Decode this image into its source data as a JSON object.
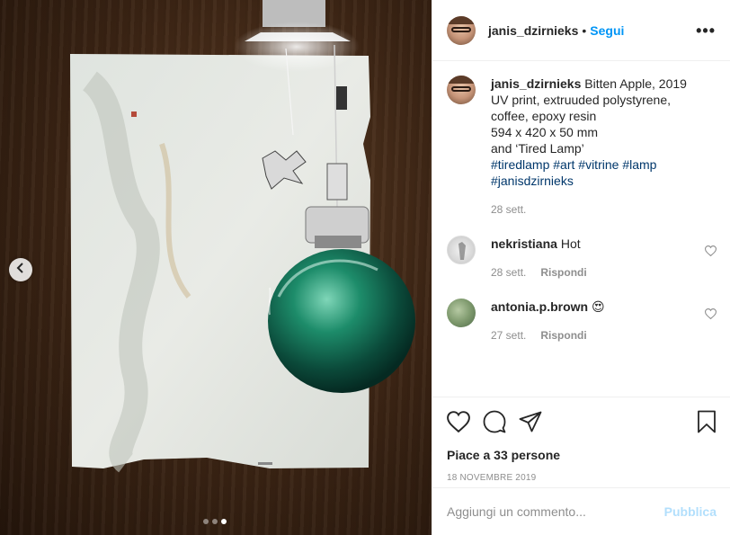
{
  "post": {
    "author": "janis_dzirnieks",
    "separator": "•",
    "follow_label": "Segui",
    "more_label": "•••",
    "caption_lines": [
      "Bitten Apple, 2019",
      "UV print, extruuded polystyrene,",
      "coffee, epoxy resin",
      "594 x 420 x 50 mm",
      "and ‘Tired Lamp’"
    ],
    "hashtags": [
      "#tiredlamp",
      "#art",
      "#vitrine",
      "#lamp",
      "#janisdzirnieks"
    ],
    "caption_age": "28 sett.",
    "likes": "Piace a 33 persone",
    "date": "18 novembre 2019"
  },
  "comments": [
    {
      "user": "nekristiana",
      "text": "Hot",
      "age": "28 sett.",
      "reply": "Rispondi"
    },
    {
      "user": "antonia.p.brown",
      "text": "😍",
      "age": "27 sett.",
      "reply": "Rispondi"
    }
  ],
  "comment_box": {
    "placeholder": "Aggiungi un commento...",
    "publish_label": "Pubblica"
  },
  "carousel": {
    "slides": 3,
    "active_index": 2
  },
  "colors": {
    "link": "#0095f6",
    "hashtag": "#00376b",
    "muted": "#8e8e8e",
    "publish_disabled": "#b2dffc",
    "heart_red": "#ed4956"
  },
  "icons": [
    "chevron-left-icon",
    "heart-icon",
    "comment-icon",
    "share-icon",
    "bookmark-icon",
    "more-icon"
  ]
}
